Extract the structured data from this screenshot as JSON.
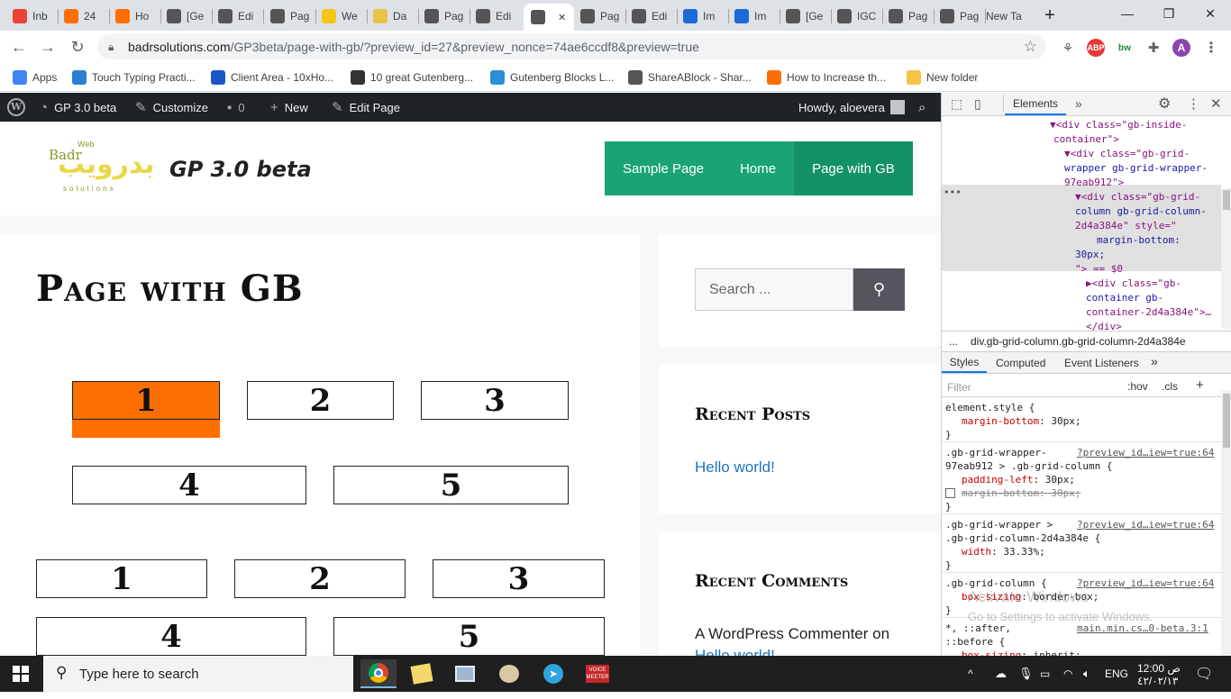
{
  "browser": {
    "tabs": [
      {
        "label": "Inb",
        "icon": "gmail-icon",
        "color": "#ea4335"
      },
      {
        "label": "24",
        "icon": "orange-icon",
        "color": "#ff6e00"
      },
      {
        "label": "Ho",
        "icon": "orange-icon",
        "color": "#ff6e00"
      },
      {
        "label": "[Ge",
        "icon": "wordpress-icon",
        "color": "#555"
      },
      {
        "label": "Edi",
        "icon": "globe-icon",
        "color": "#555"
      },
      {
        "label": "Pag",
        "icon": "globe-icon",
        "color": "#555"
      },
      {
        "label": "We",
        "icon": "p-icon",
        "color": "#f5c518"
      },
      {
        "label": "Da",
        "icon": "cloud-icon",
        "color": "#e8c34a"
      },
      {
        "label": "Pag",
        "icon": "globe-icon",
        "color": "#555"
      },
      {
        "label": "Edi",
        "icon": "globe-icon",
        "color": "#555"
      },
      {
        "label": "",
        "icon": "globe-icon",
        "color": "#555"
      },
      {
        "label": "Pag",
        "icon": "globe-icon",
        "color": "#555"
      },
      {
        "label": "Edi",
        "icon": "globe-icon",
        "color": "#555"
      },
      {
        "label": "Im",
        "icon": "ibb-icon",
        "color": "#1c6bd6"
      },
      {
        "label": "Im",
        "icon": "ibb-icon",
        "color": "#1c6bd6"
      },
      {
        "label": "[Ge",
        "icon": "wordpress-icon",
        "color": "#555"
      },
      {
        "label": "IGC",
        "icon": "globe-icon",
        "color": "#555"
      },
      {
        "label": "Pag",
        "icon": "globe-icon",
        "color": "#555"
      },
      {
        "label": "Pag",
        "icon": "globe-icon",
        "color": "#555"
      },
      {
        "label": "New Ta",
        "icon": "",
        "color": ""
      }
    ],
    "new_tab": "+",
    "url_host": "badrsolutions.com",
    "url_rest": "/GP3beta/page-with-gb/?preview_id=27&preview_nonce=74ae6ccdf8&preview=true",
    "profile_letter": "A",
    "bookmarks": [
      {
        "label": "Apps",
        "color": "#4285f4"
      },
      {
        "label": "Touch Typing Practi...",
        "color": "#2a7fd4"
      },
      {
        "label": "Client Area - 10xHo...",
        "color": "#1a56c8"
      },
      {
        "label": "10 great Gutenberg...",
        "color": "#333"
      },
      {
        "label": "Gutenberg Blocks L...",
        "color": "#2a8fd8"
      },
      {
        "label": "ShareABlock - Shar...",
        "color": "#555"
      },
      {
        "label": "How to Increase th...",
        "color": "#ff6e00"
      },
      {
        "label": "New folder",
        "color": "#f6c343"
      }
    ]
  },
  "adminbar": {
    "site": "GP 3.0 beta",
    "customize": "Customize",
    "comments": "0",
    "new": "New",
    "edit": "Edit Page",
    "howdy": "Howdy, aloevera"
  },
  "site": {
    "logo_text": "Badr",
    "logo_sub": "Web",
    "logo_arabic": "بدرويب",
    "logo_solutions": "solutions",
    "title": "GP 3.0 beta",
    "menu": [
      "Sample Page",
      "Home",
      "Page with GB"
    ],
    "page_title": "Page with GB",
    "grid1_row1": [
      "1",
      "2",
      "3"
    ],
    "grid1_row2": [
      "4",
      "5"
    ],
    "grid2_row1": [
      "1",
      "2",
      "3"
    ],
    "grid2_row2": [
      "4",
      "5"
    ],
    "search_placeholder": "Search ...",
    "recent_posts_title": "Recent Posts",
    "recent_post_link": "Hello world!",
    "recent_comments_title": "Recent Comments",
    "recent_comment_text": "A WordPress Commenter on",
    "recent_comment_link": "Hello world!"
  },
  "devtools": {
    "tab_elements": "Elements",
    "more": "»",
    "breadcrumb": "div.gb-grid-column.gb-grid-column-2d4a384e",
    "ellipsis": "...",
    "styles_tabs": [
      "Styles",
      "Computed",
      "Event Listeners"
    ],
    "filter_placeholder": "Filter",
    "hov": ":hov",
    "cls": ".cls",
    "dom_lines": [
      {
        "indent": 120,
        "text": "▼<div class=\"gb-inside-"
      },
      {
        "indent": 124,
        "text": "container\">"
      },
      {
        "indent": 136,
        "text": "▼<div class=\"gb-grid-"
      },
      {
        "indent": 136,
        "text": "wrapper gb-grid-wrapper-"
      },
      {
        "indent": 136,
        "text": "97eab912\">"
      },
      {
        "indent": 148,
        "text": "▼<div class=\"gb-grid-"
      },
      {
        "indent": 148,
        "text": "column gb-grid-column-"
      },
      {
        "indent": 148,
        "text": "2d4a384e\" style=\""
      },
      {
        "indent": 172,
        "text": "margin-bottom:"
      },
      {
        "indent": 148,
        "text": "30px;"
      },
      {
        "indent": 148,
        "text": "\"> == $0"
      },
      {
        "indent": 160,
        "text": "▶<div class=\"gb-"
      },
      {
        "indent": 160,
        "text": "container gb-"
      },
      {
        "indent": 160,
        "text": "container-2d4a384e\">…"
      },
      {
        "indent": 160,
        "text": "</div>"
      }
    ],
    "rules": [
      {
        "sel": "element.style {",
        "src": "",
        "props": [
          {
            "p": "margin-bottom",
            "v": "30px;",
            "strike": false
          }
        ]
      },
      {
        "sel": ".gb-grid-wrapper-",
        "sel2": "97eab912 > .gb-grid-column {",
        "src": "?preview_id…iew=true:64",
        "props": [
          {
            "p": "padding-left",
            "v": "30px;",
            "strike": false
          },
          {
            "p": "margin-bottom",
            "v": "30px;",
            "strike": true
          }
        ]
      },
      {
        "sel": ".gb-grid-wrapper >",
        "sel2": ".gb-grid-column-2d4a384e {",
        "src": "?preview_id…iew=true:64",
        "props": [
          {
            "p": "width",
            "v": "33.33%;",
            "strike": false
          }
        ]
      },
      {
        "sel": ".gb-grid-column {",
        "src": "?preview_id…iew=true:64",
        "props": [
          {
            "p": "box-sizing",
            "v": "border-box;",
            "strike": false
          }
        ]
      },
      {
        "sel": "*, ::after,",
        "sel2": "::before {",
        "src": "main.min.cs…0-beta.3:1",
        "props": [
          {
            "p": "box-sizing",
            "v": "inherit;",
            "strike": false
          }
        ]
      }
    ]
  },
  "watermark": {
    "line1": "Activate Windows",
    "line2": "Go to Settings to activate Windows."
  },
  "taskbar": {
    "search_placeholder": "Type here to search",
    "lang": "ENG",
    "time": "12:00 ص",
    "date": "٤٢/٠٢/١٣"
  }
}
